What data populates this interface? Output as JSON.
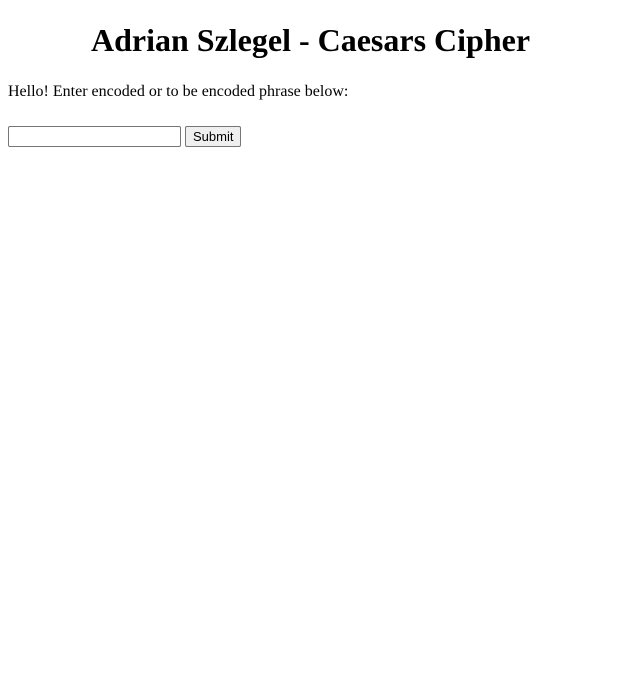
{
  "header": {
    "title": "Adrian Szlegel - Caesars Cipher"
  },
  "main": {
    "intro_text": "Hello! Enter encoded or to be encoded phrase below:",
    "form": {
      "phrase_value": "",
      "phrase_placeholder": "",
      "submit_label": "Submit"
    }
  }
}
